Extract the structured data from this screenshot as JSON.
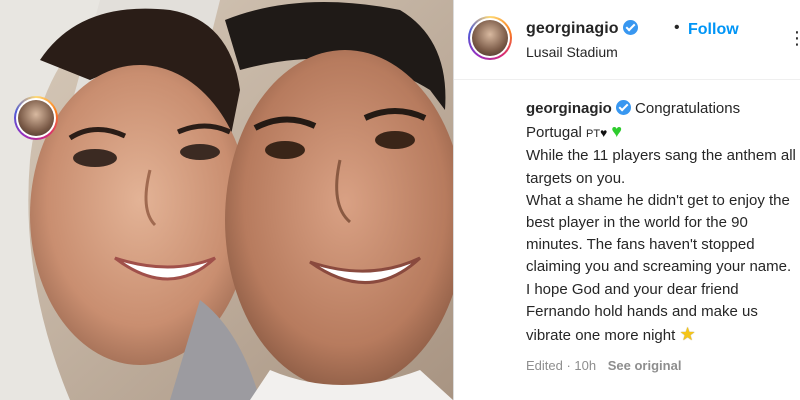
{
  "photo": {
    "icon": "couple-selfie-photo"
  },
  "header": {
    "username": "georginagio",
    "separator": "•",
    "follow_label": "Follow",
    "location": "Lusail Stadium",
    "more_icon": "⋮"
  },
  "comment": {
    "username": "georginagio",
    "caption_lead": "Congratulations Portugal",
    "flag_text": "PT",
    "black_heart": "♥",
    "green_heart": "♥",
    "body_1": "While the 11 players sang the anthem all targets on you.",
    "body_2": "What a shame he didn't get to enjoy the best player in the world for the 90 minutes. The fans haven't stopped claiming you and screaming your name.",
    "body_3": "I hope God and your dear friend Fernando hold hands and make us vibrate one more night",
    "star": "★"
  },
  "meta": {
    "edited": "Edited · 10h",
    "see_original": "See original"
  },
  "colors": {
    "accent": "#0095f6",
    "verified": "#3897f0",
    "muted": "#8e8e8e"
  }
}
